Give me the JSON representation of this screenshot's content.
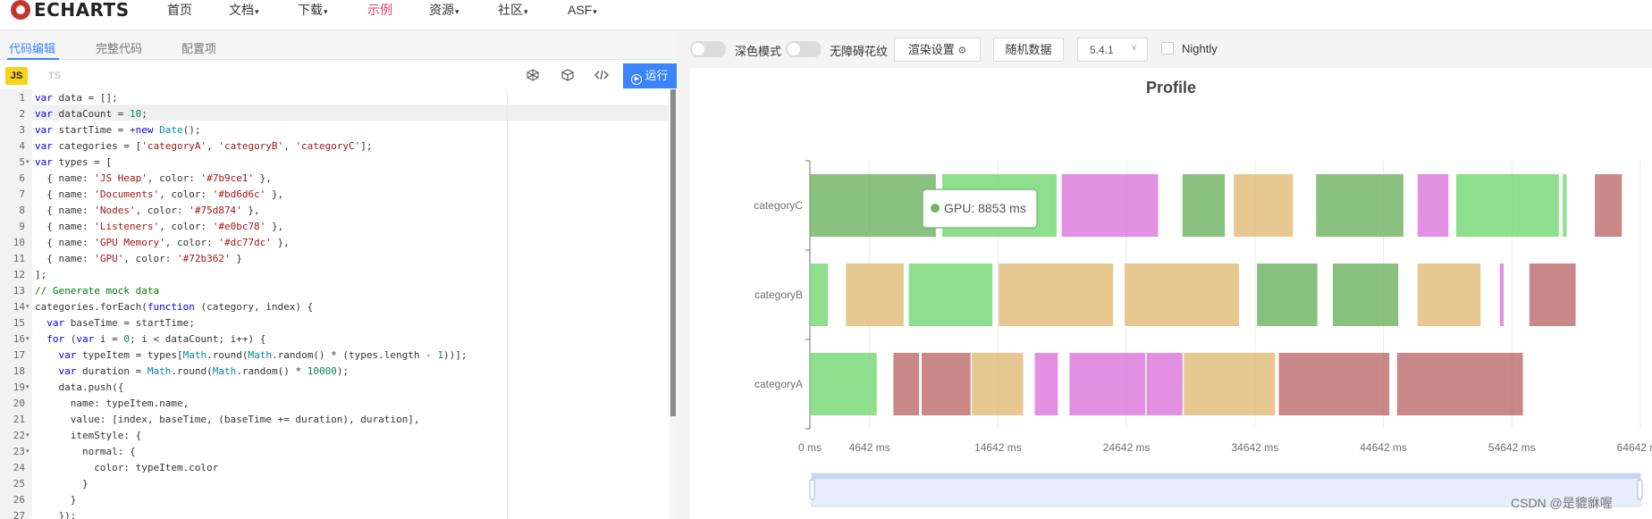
{
  "nav": {
    "logo": "ECHARTS",
    "items": [
      {
        "label": "首页",
        "dropdown": false
      },
      {
        "label": "文档",
        "dropdown": true
      },
      {
        "label": "下载",
        "dropdown": true
      },
      {
        "label": "示例",
        "dropdown": false,
        "active": true
      },
      {
        "label": "资源",
        "dropdown": true
      },
      {
        "label": "社区",
        "dropdown": true
      },
      {
        "label": "ASF",
        "dropdown": true
      }
    ]
  },
  "editor_tabs": [
    "代码编辑",
    "完整代码",
    "配置项"
  ],
  "lang": {
    "js": "JS",
    "ts": "TS"
  },
  "run_label": "运行",
  "toolbar_icons": [
    "format-icon",
    "box-icon",
    "code-icon"
  ],
  "code_lines": [
    "var data = [];",
    "var dataCount = 10;",
    "var startTime = +new Date();",
    "var categories = ['categoryA', 'categoryB', 'categoryC'];",
    "var types = [",
    "  { name: 'JS Heap', color: '#7b9ce1' },",
    "  { name: 'Documents', color: '#bd6d6c' },",
    "  { name: 'Nodes', color: '#75d874' },",
    "  { name: 'Listeners', color: '#e0bc78' },",
    "  { name: 'GPU Memory', color: '#dc77dc' },",
    "  { name: 'GPU', color: '#72b362' }",
    "];",
    "// Generate mock data",
    "categories.forEach(function (category, index) {",
    "  var baseTime = startTime;",
    "  for (var i = 0; i < dataCount; i++) {",
    "    var typeItem = types[Math.round(Math.random() * (types.length - 1))];",
    "    var duration = Math.round(Math.random() * 10000);",
    "    data.push({",
    "      name: typeItem.name,",
    "      value: [index, baseTime, (baseTime += duration), duration],",
    "      itemStyle: {",
    "        normal: {",
    "          color: typeItem.color",
    "        }",
    "      }",
    "    });"
  ],
  "fold_lines": [
    5,
    14,
    16,
    19,
    22,
    23
  ],
  "right_toolbar": {
    "dark_mode": "深色模式",
    "accessibility": "无障碍花纹",
    "render_settings": "渲染设置",
    "random_data": "随机数据",
    "version": "5.4.1",
    "nightly": "Nightly"
  },
  "chart_data": {
    "type": "profile",
    "title": "Profile",
    "categories": [
      "categoryA",
      "categoryB",
      "categoryC"
    ],
    "x_ticks": [
      "0 ms",
      "4642 ms",
      "14642 ms",
      "24642 ms",
      "34642 ms",
      "44642 ms",
      "54642 ms",
      "64642 ms"
    ],
    "x_tick_values": [
      0,
      4642,
      14642,
      24642,
      34642,
      44642,
      54642,
      64642
    ],
    "xlim": [
      0,
      64642
    ],
    "colors": {
      "JS Heap": "#7b9ce1",
      "Documents": "#bd6d6c",
      "Nodes": "#75d874",
      "Listeners": "#e0bc78",
      "GPU Memory": "#dc77dc",
      "GPU": "#72b362"
    },
    "segments": [
      {
        "category": "categoryC",
        "type": "GPU",
        "start": 0,
        "end": 9800
      },
      {
        "category": "categoryC",
        "type": "Nodes",
        "start": 10300,
        "end": 19200
      },
      {
        "category": "categoryC",
        "type": "GPU Memory",
        "start": 19600,
        "end": 27100
      },
      {
        "category": "categoryC",
        "type": "GPU",
        "start": 29000,
        "end": 32300
      },
      {
        "category": "categoryC",
        "type": "Listeners",
        "start": 33000,
        "end": 37600
      },
      {
        "category": "categoryC",
        "type": "GPU",
        "start": 39400,
        "end": 46200
      },
      {
        "category": "categoryC",
        "type": "GPU Memory",
        "start": 47300,
        "end": 49700
      },
      {
        "category": "categoryC",
        "type": "Nodes",
        "start": 50300,
        "end": 58300
      },
      {
        "category": "categoryC",
        "type": "Nodes",
        "start": 58600,
        "end": 58900
      },
      {
        "category": "categoryC",
        "type": "Documents",
        "start": 61100,
        "end": 63200
      },
      {
        "category": "categoryB",
        "type": "Nodes",
        "start": 0,
        "end": 1400
      },
      {
        "category": "categoryB",
        "type": "Listeners",
        "start": 2800,
        "end": 7300
      },
      {
        "category": "categoryB",
        "type": "Nodes",
        "start": 7700,
        "end": 14200
      },
      {
        "category": "categoryB",
        "type": "Listeners",
        "start": 14700,
        "end": 23600
      },
      {
        "category": "categoryB",
        "type": "Listeners",
        "start": 24500,
        "end": 33400
      },
      {
        "category": "categoryB",
        "type": "GPU",
        "start": 34800,
        "end": 39500
      },
      {
        "category": "categoryB",
        "type": "GPU",
        "start": 40700,
        "end": 45800
      },
      {
        "category": "categoryB",
        "type": "Listeners",
        "start": 47300,
        "end": 52200
      },
      {
        "category": "categoryB",
        "type": "GPU Memory",
        "start": 53700,
        "end": 54000
      },
      {
        "category": "categoryB",
        "type": "Documents",
        "start": 56000,
        "end": 59600
      },
      {
        "category": "categoryA",
        "type": "Nodes",
        "start": 0,
        "end": 5200
      },
      {
        "category": "categoryA",
        "type": "Documents",
        "start": 6500,
        "end": 8500
      },
      {
        "category": "categoryA",
        "type": "Documents",
        "start": 8700,
        "end": 12500
      },
      {
        "category": "categoryA",
        "type": "Listeners",
        "start": 12600,
        "end": 16600
      },
      {
        "category": "categoryA",
        "type": "GPU Memory",
        "start": 17500,
        "end": 19300
      },
      {
        "category": "categoryA",
        "type": "GPU Memory",
        "start": 20200,
        "end": 26100
      },
      {
        "category": "categoryA",
        "type": "GPU Memory",
        "start": 26200,
        "end": 29000
      },
      {
        "category": "categoryA",
        "type": "Listeners",
        "start": 29100,
        "end": 36200
      },
      {
        "category": "categoryA",
        "type": "Documents",
        "start": 36500,
        "end": 45100
      },
      {
        "category": "categoryA",
        "type": "Documents",
        "start": 45700,
        "end": 55500
      }
    ],
    "tooltip": {
      "text": "GPU: 8853 ms",
      "color": "#72b362",
      "category": "categoryC"
    }
  },
  "watermark": "CSDN @是貔貅喔"
}
